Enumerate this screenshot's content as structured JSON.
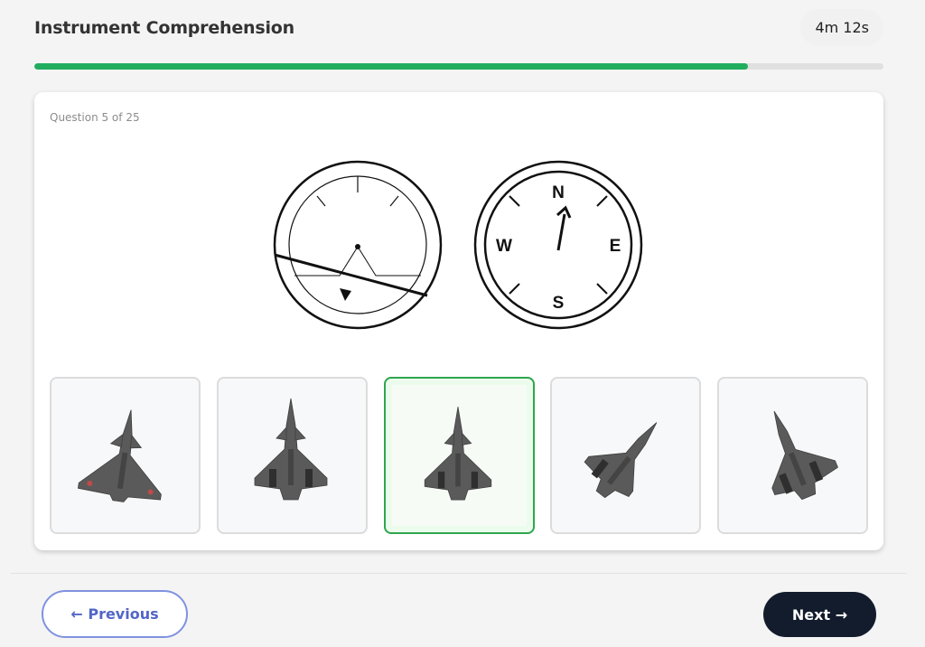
{
  "header": {
    "title": "Instrument Comprehension",
    "timer": "4m 12s"
  },
  "progress": {
    "fraction": 0.84
  },
  "question": {
    "counter": "Question 5 of 25"
  },
  "instruments": {
    "compass_labels": {
      "north": "N",
      "east": "E",
      "south": "S",
      "west": "W"
    }
  },
  "options": [
    {
      "id": "option-1",
      "selected": false
    },
    {
      "id": "option-2",
      "selected": false
    },
    {
      "id": "option-3",
      "selected": true
    },
    {
      "id": "option-4",
      "selected": false
    },
    {
      "id": "option-5",
      "selected": false
    }
  ],
  "nav": {
    "previous_label": "← Previous",
    "next_label": "Next →"
  },
  "colors": {
    "progress": "#21ad5e",
    "selected_border": "#2ea64e",
    "previous_accent": "#5266c8",
    "next_background": "#121c2c"
  }
}
